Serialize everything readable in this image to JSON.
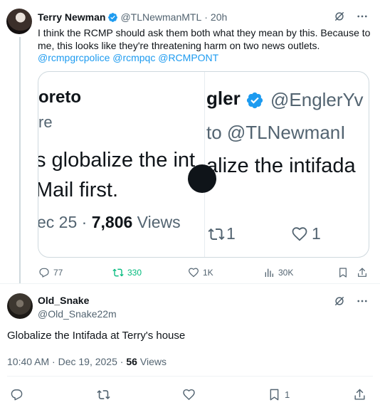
{
  "tweet1": {
    "author_name": "Terry Newman",
    "handle": "@TLNewmanMTL",
    "time": "20h",
    "body": "I think the RCMP should ask them both what they mean by this. Because to me, this looks like they're threatening harm on two news outlets.",
    "mentions": "@rcmpgrcpolice @rcmpqc @RCMPONT",
    "icons": {
      "grok": "grok-icon",
      "more": "more-icon",
      "verified": "verified-badge-icon"
    },
    "media": {
      "left": {
        "name_fragment": "oreto",
        "handle_fragment": "re",
        "line1": "s globalize the int",
        "line2": "Mail first.",
        "date_fragment": "ec 25 ·",
        "views_count": "7,806",
        "views_label": "Views"
      },
      "right": {
        "name_fragment": "gler",
        "handle_fragment": "@EnglerYv",
        "reply_to": "to @TLNewmanI",
        "line1": "alize the intifada",
        "retweets": "1",
        "likes": "1"
      }
    },
    "actions": {
      "replies": "77",
      "reposts": "330",
      "likes": "1K",
      "views": "30K"
    }
  },
  "tweet2": {
    "author_name": "Old_Snake",
    "handle": "@Old_Snake22m",
    "body": "Globalize the Intifada at Terry's house",
    "time": "10:40 AM · Dec 19, 2025 ·",
    "views_count": "56",
    "views_label": "Views",
    "actions": {
      "bookmarks": "1"
    }
  },
  "colors": {
    "accent": "#1d9bf0",
    "repost": "#00ba7c",
    "muted": "#536471"
  }
}
